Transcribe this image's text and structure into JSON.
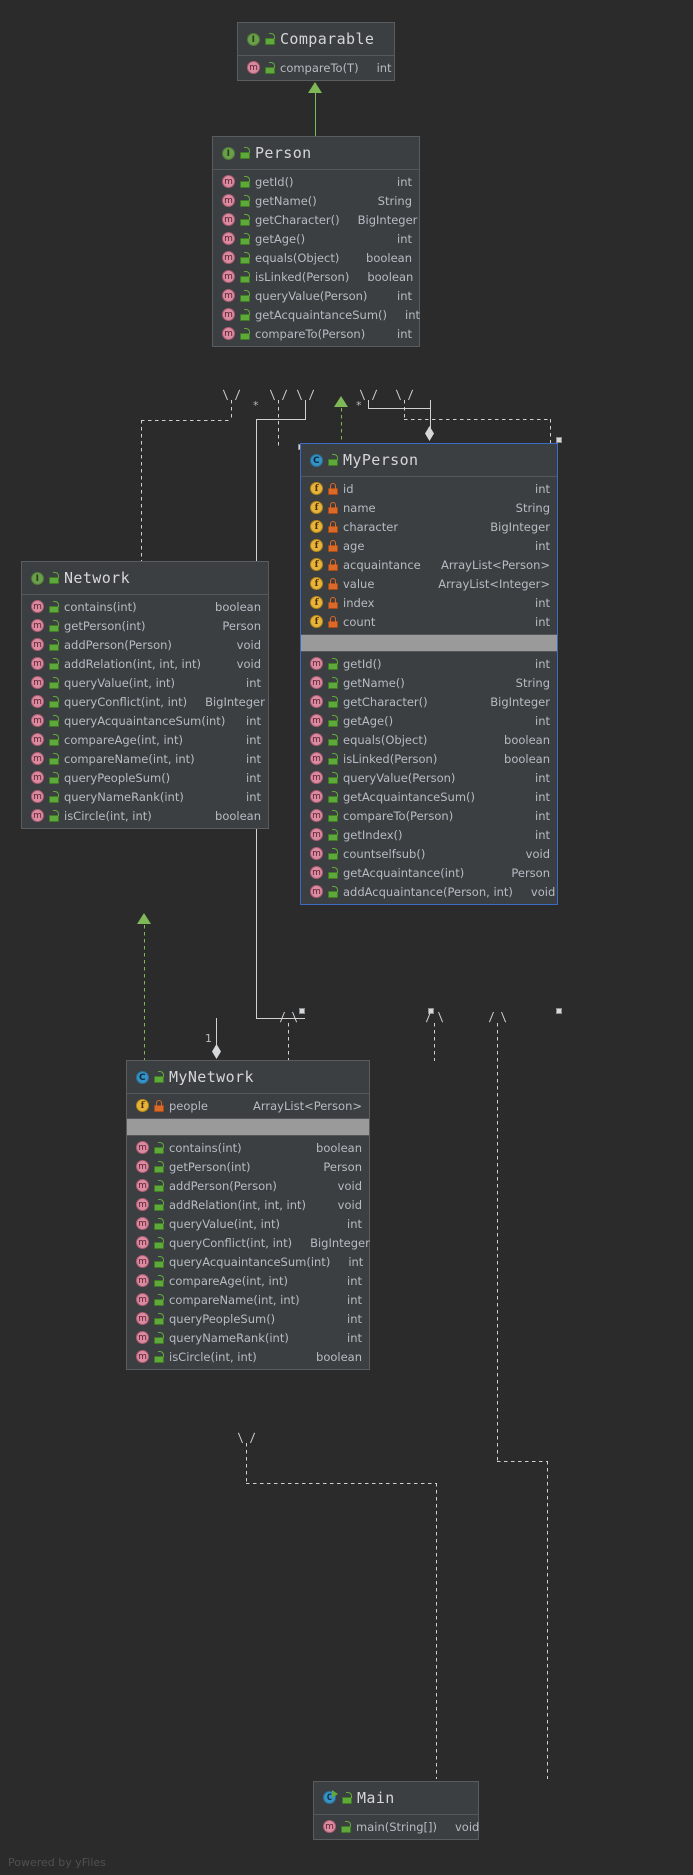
{
  "diagram": {
    "title": "UML Class Diagram",
    "watermark": "Powered by yFiles",
    "background_color": "#2b2b2b",
    "selection_color": "#3b6cc4"
  },
  "classes": [
    {
      "id": "comparable",
      "name": "Comparable",
      "stereotype": "interface",
      "icon": "interface-icon",
      "visibility_icon": "lock-public-icon",
      "selected": false,
      "fields": [],
      "methods": [
        {
          "name": "compareTo(T)",
          "type": "int",
          "icon": "method-icon",
          "visibility_icon": "lock-public-icon"
        }
      ]
    },
    {
      "id": "person",
      "name": "Person",
      "stereotype": "interface",
      "icon": "interface-icon",
      "visibility_icon": "lock-public-icon",
      "selected": false,
      "fields": [],
      "methods": [
        {
          "name": "getId()",
          "type": "int",
          "icon": "method-icon",
          "visibility_icon": "lock-public-icon"
        },
        {
          "name": "getName()",
          "type": "String",
          "icon": "method-icon",
          "visibility_icon": "lock-public-icon"
        },
        {
          "name": "getCharacter()",
          "type": "BigInteger",
          "icon": "method-icon",
          "visibility_icon": "lock-public-icon"
        },
        {
          "name": "getAge()",
          "type": "int",
          "icon": "method-icon",
          "visibility_icon": "lock-public-icon"
        },
        {
          "name": "equals(Object)",
          "type": "boolean",
          "icon": "method-icon",
          "visibility_icon": "lock-public-icon"
        },
        {
          "name": "isLinked(Person)",
          "type": "boolean",
          "icon": "method-icon",
          "visibility_icon": "lock-public-icon"
        },
        {
          "name": "queryValue(Person)",
          "type": "int",
          "icon": "method-icon",
          "visibility_icon": "lock-public-icon"
        },
        {
          "name": "getAcquaintanceSum()",
          "type": "int",
          "icon": "method-icon",
          "visibility_icon": "lock-public-icon"
        },
        {
          "name": "compareTo(Person)",
          "type": "int",
          "icon": "method-icon",
          "visibility_icon": "lock-public-icon"
        }
      ]
    },
    {
      "id": "network",
      "name": "Network",
      "stereotype": "interface",
      "icon": "interface-icon",
      "visibility_icon": "lock-public-icon",
      "selected": false,
      "fields": [],
      "methods": [
        {
          "name": "contains(int)",
          "type": "boolean",
          "icon": "method-icon",
          "visibility_icon": "lock-public-icon"
        },
        {
          "name": "getPerson(int)",
          "type": "Person",
          "icon": "method-icon",
          "visibility_icon": "lock-public-icon"
        },
        {
          "name": "addPerson(Person)",
          "type": "void",
          "icon": "method-icon",
          "visibility_icon": "lock-public-icon"
        },
        {
          "name": "addRelation(int, int, int)",
          "type": "void",
          "icon": "method-icon",
          "visibility_icon": "lock-public-icon"
        },
        {
          "name": "queryValue(int, int)",
          "type": "int",
          "icon": "method-icon",
          "visibility_icon": "lock-public-icon"
        },
        {
          "name": "queryConflict(int, int)",
          "type": "BigInteger",
          "icon": "method-icon",
          "visibility_icon": "lock-public-icon"
        },
        {
          "name": "queryAcquaintanceSum(int)",
          "type": "int",
          "icon": "method-icon",
          "visibility_icon": "lock-public-icon"
        },
        {
          "name": "compareAge(int, int)",
          "type": "int",
          "icon": "method-icon",
          "visibility_icon": "lock-public-icon"
        },
        {
          "name": "compareName(int, int)",
          "type": "int",
          "icon": "method-icon",
          "visibility_icon": "lock-public-icon"
        },
        {
          "name": "queryPeopleSum()",
          "type": "int",
          "icon": "method-icon",
          "visibility_icon": "lock-public-icon"
        },
        {
          "name": "queryNameRank(int)",
          "type": "int",
          "icon": "method-icon",
          "visibility_icon": "lock-public-icon"
        },
        {
          "name": "isCircle(int, int)",
          "type": "boolean",
          "icon": "method-icon",
          "visibility_icon": "lock-public-icon"
        }
      ]
    },
    {
      "id": "myperson",
      "name": "MyPerson",
      "stereotype": "class",
      "icon": "class-icon",
      "visibility_icon": "lock-public-icon",
      "selected": true,
      "fields": [
        {
          "name": "id",
          "type": "int",
          "icon": "field-icon",
          "visibility_icon": "lock-private-icon"
        },
        {
          "name": "name",
          "type": "String",
          "icon": "field-icon",
          "visibility_icon": "lock-private-icon"
        },
        {
          "name": "character",
          "type": "BigInteger",
          "icon": "field-icon",
          "visibility_icon": "lock-private-icon"
        },
        {
          "name": "age",
          "type": "int",
          "icon": "field-icon",
          "visibility_icon": "lock-private-icon"
        },
        {
          "name": "acquaintance",
          "type": "ArrayList<Person>",
          "icon": "field-icon",
          "visibility_icon": "lock-private-icon"
        },
        {
          "name": "value",
          "type": "ArrayList<Integer>",
          "icon": "field-icon",
          "visibility_icon": "lock-private-icon"
        },
        {
          "name": "index",
          "type": "int",
          "icon": "field-icon",
          "visibility_icon": "lock-private-icon"
        },
        {
          "name": "count",
          "type": "int",
          "icon": "field-icon",
          "visibility_icon": "lock-private-icon"
        }
      ],
      "methods": [
        {
          "name": "getId()",
          "type": "int",
          "icon": "method-icon",
          "visibility_icon": "lock-public-icon"
        },
        {
          "name": "getName()",
          "type": "String",
          "icon": "method-icon",
          "visibility_icon": "lock-public-icon"
        },
        {
          "name": "getCharacter()",
          "type": "BigInteger",
          "icon": "method-icon",
          "visibility_icon": "lock-public-icon"
        },
        {
          "name": "getAge()",
          "type": "int",
          "icon": "method-icon",
          "visibility_icon": "lock-public-icon"
        },
        {
          "name": "equals(Object)",
          "type": "boolean",
          "icon": "method-icon",
          "visibility_icon": "lock-public-icon"
        },
        {
          "name": "isLinked(Person)",
          "type": "boolean",
          "icon": "method-icon",
          "visibility_icon": "lock-public-icon"
        },
        {
          "name": "queryValue(Person)",
          "type": "int",
          "icon": "method-icon",
          "visibility_icon": "lock-public-icon"
        },
        {
          "name": "getAcquaintanceSum()",
          "type": "int",
          "icon": "method-icon",
          "visibility_icon": "lock-public-icon"
        },
        {
          "name": "compareTo(Person)",
          "type": "int",
          "icon": "method-icon",
          "visibility_icon": "lock-public-icon"
        },
        {
          "name": "getIndex()",
          "type": "int",
          "icon": "method-icon",
          "visibility_icon": "lock-public-icon"
        },
        {
          "name": "countselfsub()",
          "type": "void",
          "icon": "method-icon",
          "visibility_icon": "lock-public-icon"
        },
        {
          "name": "getAcquaintance(int)",
          "type": "Person",
          "icon": "method-icon",
          "visibility_icon": "lock-public-icon"
        },
        {
          "name": "addAcquaintance(Person, int)",
          "type": "void",
          "icon": "method-icon",
          "visibility_icon": "lock-public-icon"
        }
      ]
    },
    {
      "id": "mynetwork",
      "name": "MyNetwork",
      "stereotype": "class",
      "icon": "class-icon",
      "visibility_icon": "lock-public-icon",
      "selected": false,
      "fields": [
        {
          "name": "people",
          "type": "ArrayList<Person>",
          "icon": "field-icon",
          "visibility_icon": "lock-private-icon"
        }
      ],
      "methods": [
        {
          "name": "contains(int)",
          "type": "boolean",
          "icon": "method-icon",
          "visibility_icon": "lock-public-icon"
        },
        {
          "name": "getPerson(int)",
          "type": "Person",
          "icon": "method-icon",
          "visibility_icon": "lock-public-icon"
        },
        {
          "name": "addPerson(Person)",
          "type": "void",
          "icon": "method-icon",
          "visibility_icon": "lock-public-icon"
        },
        {
          "name": "addRelation(int, int, int)",
          "type": "void",
          "icon": "method-icon",
          "visibility_icon": "lock-public-icon"
        },
        {
          "name": "queryValue(int, int)",
          "type": "int",
          "icon": "method-icon",
          "visibility_icon": "lock-public-icon"
        },
        {
          "name": "queryConflict(int, int)",
          "type": "BigInteger",
          "icon": "method-icon",
          "visibility_icon": "lock-public-icon"
        },
        {
          "name": "queryAcquaintanceSum(int)",
          "type": "int",
          "icon": "method-icon",
          "visibility_icon": "lock-public-icon"
        },
        {
          "name": "compareAge(int, int)",
          "type": "int",
          "icon": "method-icon",
          "visibility_icon": "lock-public-icon"
        },
        {
          "name": "compareName(int, int)",
          "type": "int",
          "icon": "method-icon",
          "visibility_icon": "lock-public-icon"
        },
        {
          "name": "queryPeopleSum()",
          "type": "int",
          "icon": "method-icon",
          "visibility_icon": "lock-public-icon"
        },
        {
          "name": "queryNameRank(int)",
          "type": "int",
          "icon": "method-icon",
          "visibility_icon": "lock-public-icon"
        },
        {
          "name": "isCircle(int, int)",
          "type": "boolean",
          "icon": "method-icon",
          "visibility_icon": "lock-public-icon"
        }
      ]
    },
    {
      "id": "main",
      "name": "Main",
      "stereotype": "class-runnable",
      "icon": "class-run-icon",
      "visibility_icon": "lock-public-icon",
      "selected": false,
      "fields": [],
      "methods": [
        {
          "name": "main(String[])",
          "type": "void",
          "icon": "method-icon",
          "visibility_icon": "lock-public-icon"
        }
      ]
    }
  ],
  "multiplicities": [
    "*",
    "*",
    "1"
  ]
}
